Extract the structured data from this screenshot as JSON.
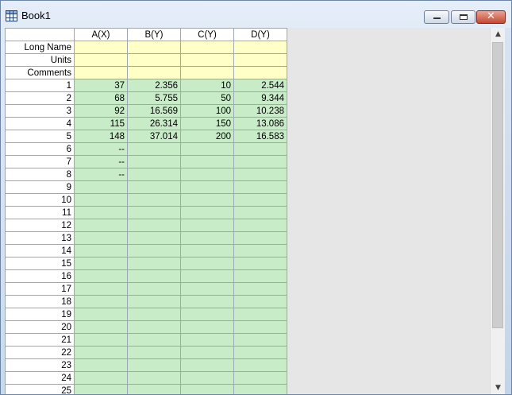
{
  "window": {
    "title": "Book1"
  },
  "columns": [
    "A(X)",
    "B(Y)",
    "C(Y)",
    "D(Y)"
  ],
  "meta_rows": [
    "Long Name",
    "Units",
    "Comments"
  ],
  "rows": [
    {
      "n": "1",
      "a": "37",
      "b": "2.356",
      "c": "10",
      "d": "2.544"
    },
    {
      "n": "2",
      "a": "68",
      "b": "5.755",
      "c": "50",
      "d": "9.344"
    },
    {
      "n": "3",
      "a": "92",
      "b": "16.569",
      "c": "100",
      "d": "10.238"
    },
    {
      "n": "4",
      "a": "115",
      "b": "26.314",
      "c": "150",
      "d": "13.086"
    },
    {
      "n": "5",
      "a": "148",
      "b": "37.014",
      "c": "200",
      "d": "16.583"
    },
    {
      "n": "6",
      "a": "--",
      "b": "",
      "c": "",
      "d": ""
    },
    {
      "n": "7",
      "a": "--",
      "b": "",
      "c": "",
      "d": ""
    },
    {
      "n": "8",
      "a": "--",
      "b": "",
      "c": "",
      "d": ""
    },
    {
      "n": "9",
      "a": "",
      "b": "",
      "c": "",
      "d": ""
    },
    {
      "n": "10",
      "a": "",
      "b": "",
      "c": "",
      "d": ""
    },
    {
      "n": "11",
      "a": "",
      "b": "",
      "c": "",
      "d": ""
    },
    {
      "n": "12",
      "a": "",
      "b": "",
      "c": "",
      "d": ""
    },
    {
      "n": "13",
      "a": "",
      "b": "",
      "c": "",
      "d": ""
    },
    {
      "n": "14",
      "a": "",
      "b": "",
      "c": "",
      "d": ""
    },
    {
      "n": "15",
      "a": "",
      "b": "",
      "c": "",
      "d": ""
    },
    {
      "n": "16",
      "a": "",
      "b": "",
      "c": "",
      "d": ""
    },
    {
      "n": "17",
      "a": "",
      "b": "",
      "c": "",
      "d": ""
    },
    {
      "n": "18",
      "a": "",
      "b": "",
      "c": "",
      "d": ""
    },
    {
      "n": "19",
      "a": "",
      "b": "",
      "c": "",
      "d": ""
    },
    {
      "n": "20",
      "a": "",
      "b": "",
      "c": "",
      "d": ""
    },
    {
      "n": "21",
      "a": "",
      "b": "",
      "c": "",
      "d": ""
    },
    {
      "n": "22",
      "a": "",
      "b": "",
      "c": "",
      "d": ""
    },
    {
      "n": "23",
      "a": "",
      "b": "",
      "c": "",
      "d": ""
    },
    {
      "n": "24",
      "a": "",
      "b": "",
      "c": "",
      "d": ""
    },
    {
      "n": "25",
      "a": "",
      "b": "",
      "c": "",
      "d": ""
    }
  ],
  "icons": {
    "app": "worksheet-grid-icon",
    "minimize": "minimize-icon",
    "maximize": "restore-icon",
    "close": "close-icon",
    "scroll_up": "chevron-up-icon",
    "scroll_down": "chevron-down-icon"
  },
  "colors": {
    "meta_bg": "#ffffc8",
    "data_bg": "#c8ecc8",
    "close_button": "#c44a32"
  }
}
